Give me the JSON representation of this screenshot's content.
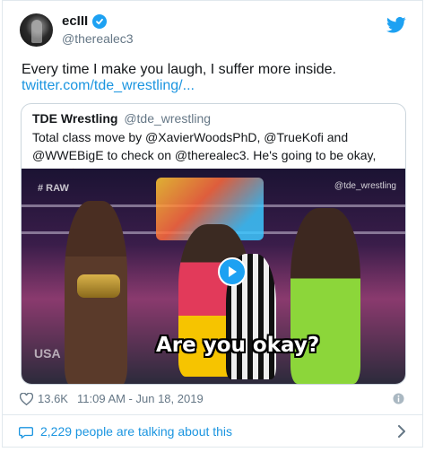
{
  "author": {
    "name": "ecIII",
    "handle": "@therealec3"
  },
  "tweet": {
    "text": "Every time I make you laugh, I suffer more inside.",
    "link": "twitter.com/tde_wrestling/..."
  },
  "quoted": {
    "name": "TDE Wrestling",
    "handle": "@tde_wrestling",
    "text": "Total class move by @XavierWoodsPhD, @TrueKofi and @WWEBigE to check on @therealec3. He's going to be okay, folks!",
    "media": {
      "caption": "Are you okay?",
      "watermark": "@tde_wrestling",
      "corner_tag": "# RAW",
      "network_tag": "USA"
    }
  },
  "meta": {
    "likes": "13.6K",
    "timestamp": "11:09 AM - Jun 18, 2019"
  },
  "footer": {
    "talking": "2,229 people are talking about this"
  },
  "colors": {
    "accent": "#1da1f2",
    "link": "#1b95e0",
    "secondary_text": "#657786"
  },
  "icons": [
    "verified-badge-icon",
    "twitter-bird-icon",
    "play-icon",
    "heart-icon",
    "info-icon",
    "comment-icon",
    "chevron-right-icon",
    "thumbs-up-emoji"
  ]
}
